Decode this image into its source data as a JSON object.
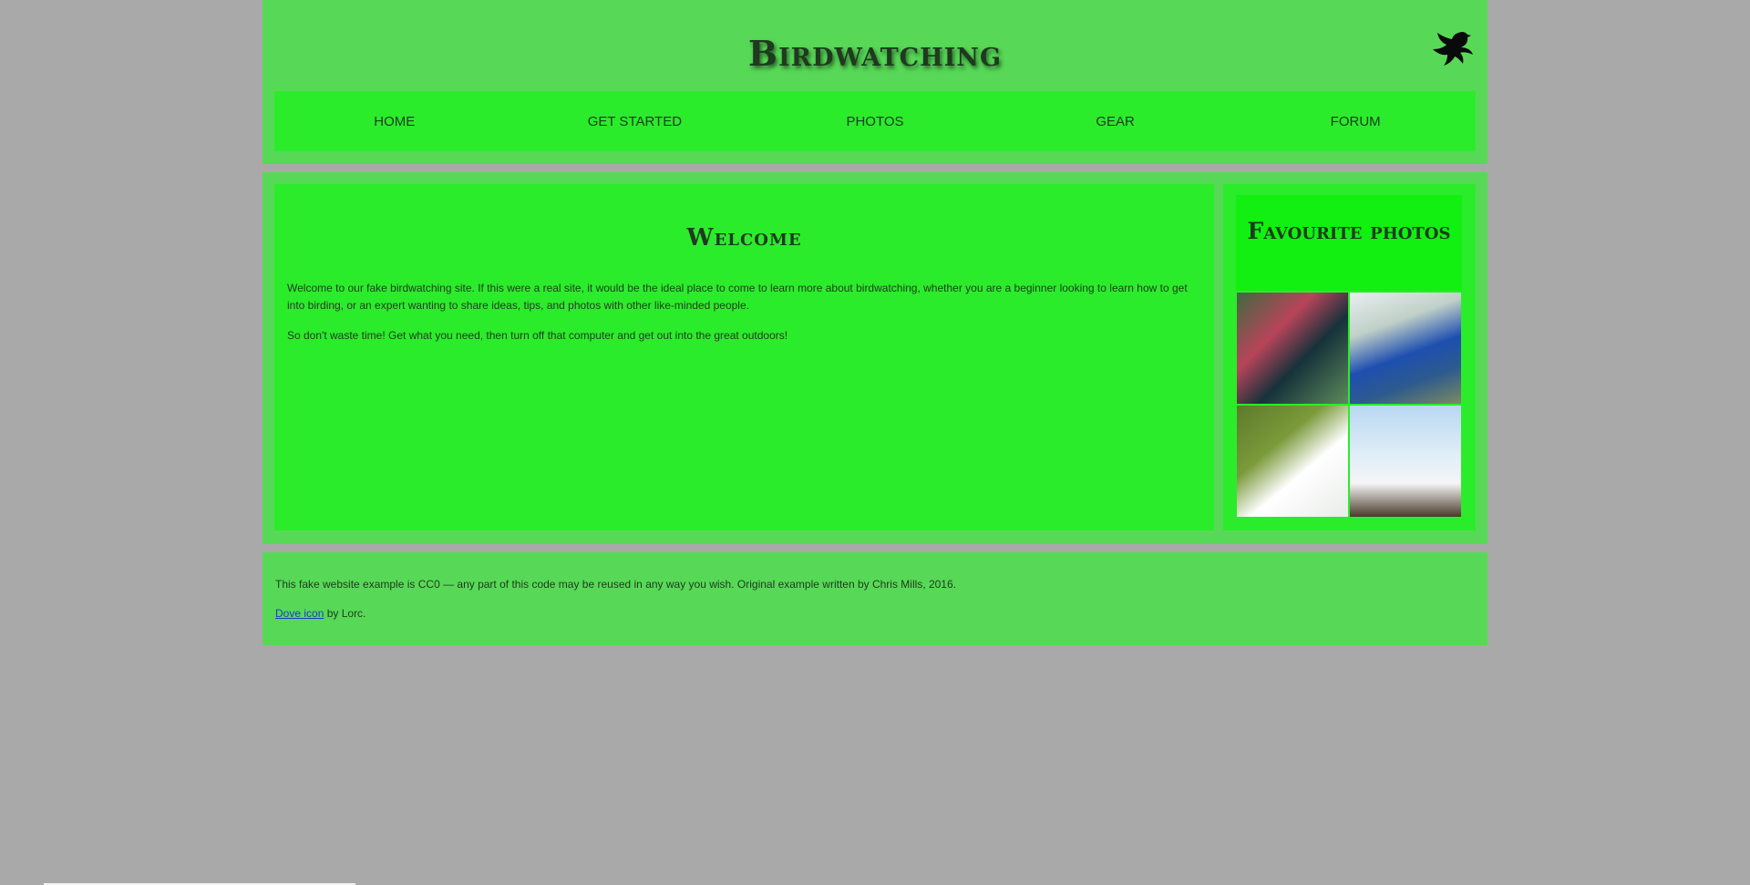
{
  "header": {
    "title": "Birdwatching",
    "logo_icon": "dove-icon"
  },
  "nav": {
    "items": [
      {
        "label": "Home"
      },
      {
        "label": "Get started"
      },
      {
        "label": "Photos"
      },
      {
        "label": "Gear"
      },
      {
        "label": "Forum"
      }
    ]
  },
  "article": {
    "heading": "Welcome",
    "paragraphs": [
      "Welcome to our fake birdwatching site. If this were a real site, it would be the ideal place to come to learn more about birdwatching, whether you are a beginner looking to learn how to get into birding, or an expert wanting to share ideas, tips, and photos with other like-minded people.",
      "So don't waste time! Get what you need, then turn off that computer and get out into the great outdoors!"
    ]
  },
  "aside": {
    "heading": "Favourite photos",
    "photos": [
      "tui-photo",
      "peacock-photo",
      "ibis-photo",
      "pelican-photo"
    ]
  },
  "footer": {
    "license_text": "This fake website example is CC0 — any part of this code may be reused in any way you wish. Original example written by Chris Mills, 2016.",
    "credit_link": "Dove icon",
    "credit_suffix": " by Lorc."
  },
  "colors": {
    "page_bg": "#a9a9a9",
    "panel": "#57d957",
    "content": "#2bec2b",
    "aside_header": "#11f011",
    "text": "#1f3a1f"
  }
}
